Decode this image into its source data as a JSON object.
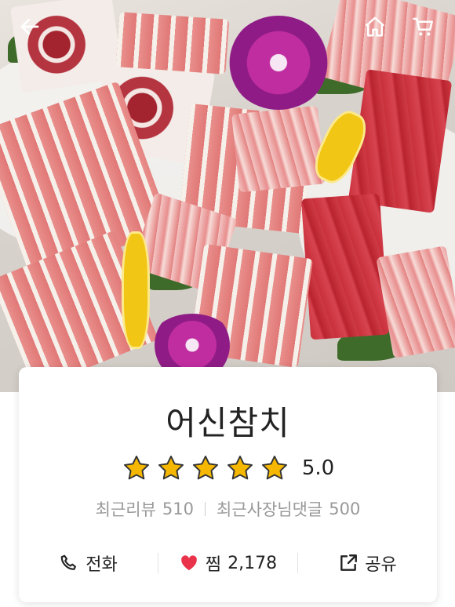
{
  "header": {
    "back_icon": "back-arrow-icon",
    "home_icon": "home-icon",
    "cart_icon": "cart-icon"
  },
  "store": {
    "name": "어신참치",
    "rating": {
      "stars_filled": 5,
      "stars_total": 5,
      "value": "5.0",
      "star_color": "#f5b700"
    },
    "reviews": {
      "recent_review_label": "최근리뷰",
      "recent_review_count": "510",
      "owner_reply_label": "최근사장님댓글",
      "owner_reply_count": "500"
    }
  },
  "actions": [
    {
      "label": "전화",
      "icon": "phone-icon"
    },
    {
      "label": "찜",
      "count": "2,178",
      "icon": "heart-icon",
      "color": "#e8334a"
    },
    {
      "label": "공유",
      "icon": "share-icon"
    }
  ],
  "colors": {
    "text": "#222222",
    "muted": "#999999",
    "heart": "#e8334a"
  }
}
